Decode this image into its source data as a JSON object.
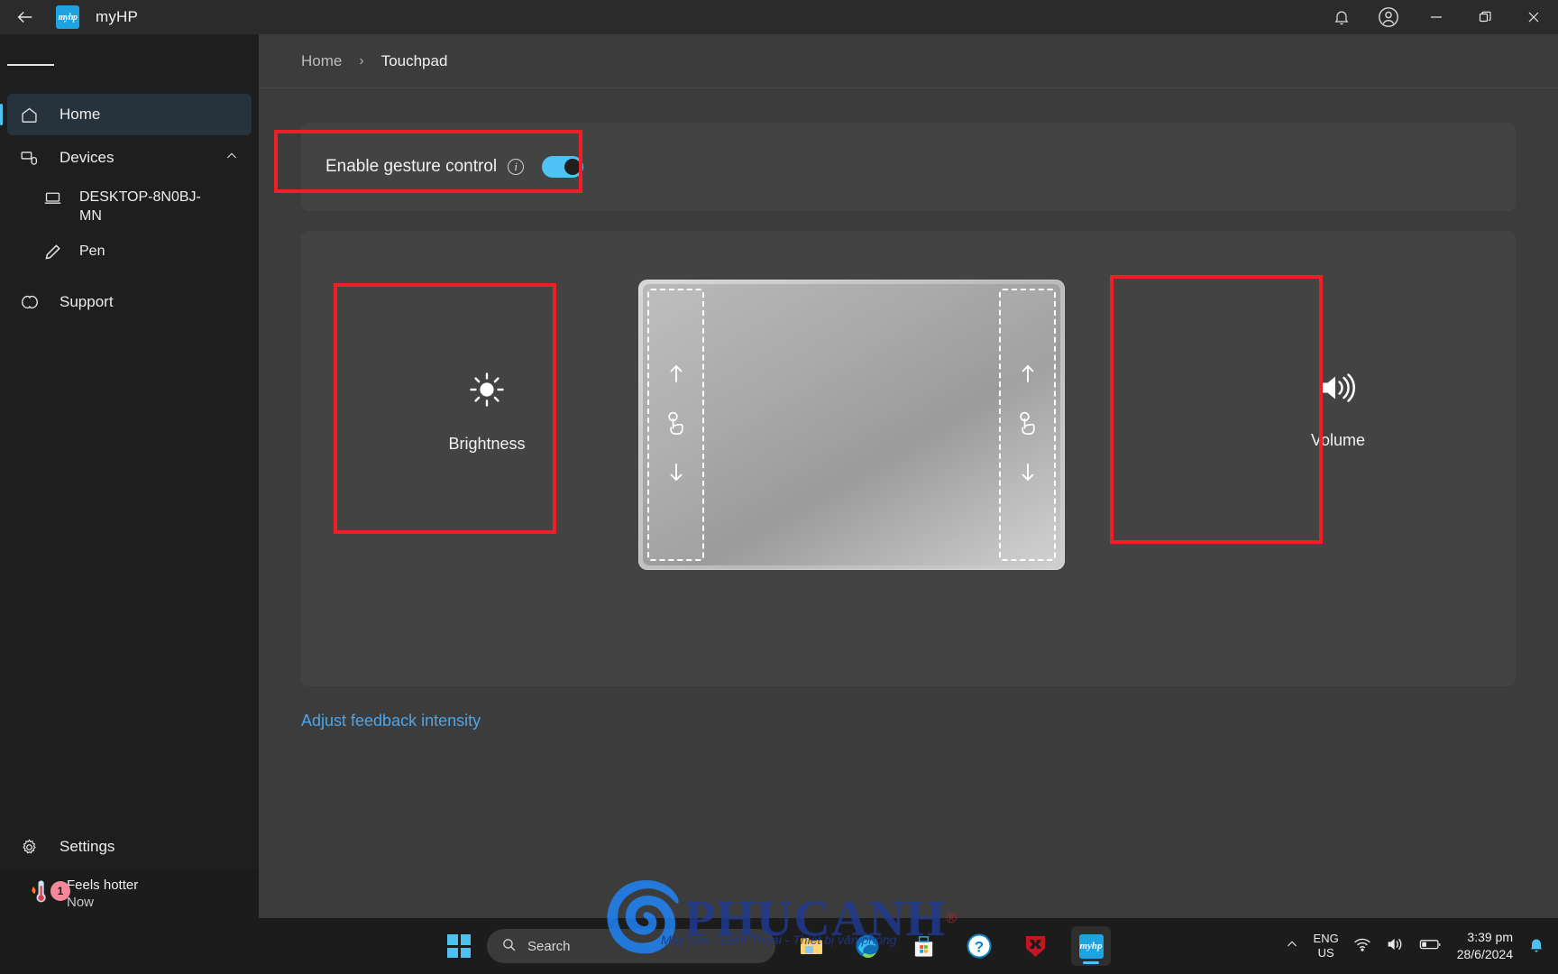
{
  "window": {
    "title": "myHP",
    "logo_text": "myhp",
    "back_icon": "back-arrow-icon",
    "notification_icon": "bell-icon",
    "account_icon": "account-icon",
    "minimize_label": "–",
    "restore_label": "❐",
    "close_label": "✕"
  },
  "sidebar": {
    "menu_icon": "hamburger-icon",
    "items": [
      {
        "label": "Home",
        "icon": "home-icon",
        "active": true
      },
      {
        "label": "Devices",
        "icon": "devices-icon",
        "expanded": true
      },
      {
        "label": "DESKTOP-8N0BJ-MN",
        "icon": "laptop-icon",
        "sub": true
      },
      {
        "label": "Pen",
        "icon": "pen-icon",
        "sub": true
      },
      {
        "label": "Support",
        "icon": "support-icon"
      }
    ],
    "settings": {
      "label": "Settings",
      "icon": "gear-icon"
    },
    "weather": {
      "title": "Feels hotter",
      "subtitle": "Now",
      "badge": "1",
      "icon": "thermometer-flame-icon"
    }
  },
  "breadcrumb": {
    "home": "Home",
    "separator": "›",
    "current": "Touchpad"
  },
  "gesture_card": {
    "label": "Enable gesture control",
    "info_icon": "info-icon",
    "info_glyph": "i",
    "toggle_state": "on",
    "toggle_color": "#4fc3f7"
  },
  "gestures": {
    "left": {
      "label": "Brightness",
      "icon": "brightness-sun-icon"
    },
    "right": {
      "label": "Volume",
      "icon": "volume-speaker-icon"
    },
    "touchpad": {
      "name": "touchpad-diagram",
      "left_zone": {
        "up_icon": "arrow-up-icon",
        "touch_icon": "tap-hand-icon",
        "down_icon": "arrow-down-icon"
      },
      "right_zone": {
        "up_icon": "arrow-up-icon",
        "touch_icon": "tap-hand-icon",
        "down_icon": "arrow-down-icon"
      }
    }
  },
  "feedback_link": "Adjust feedback intensity",
  "annotations": {
    "color": "#f01f25",
    "count": 3
  },
  "taskbar": {
    "start_icon": "windows-start-icon",
    "search": {
      "placeholder": "Search",
      "icon": "search-icon"
    },
    "apps": [
      {
        "name": "file-explorer-icon"
      },
      {
        "name": "edge-browser-icon"
      },
      {
        "name": "microsoft-store-icon"
      },
      {
        "name": "help-icon"
      },
      {
        "name": "mcafee-icon"
      },
      {
        "name": "myhp-icon",
        "label": "myhp",
        "active": true
      }
    ],
    "tray": {
      "chevron": "⌃",
      "language": {
        "line1": "ENG",
        "line2": "US"
      },
      "wifi_icon": "wifi-icon",
      "volume_icon": "volume-icon",
      "battery_icon": "battery-icon",
      "time": "3:39 pm",
      "date": "28/6/2024",
      "bell_icon": "notification-bell-icon"
    }
  },
  "watermark": {
    "brand": "PHUCANH",
    "tagline": "Máy tính - Điện Thoại - Thiết bị văn phòng"
  }
}
